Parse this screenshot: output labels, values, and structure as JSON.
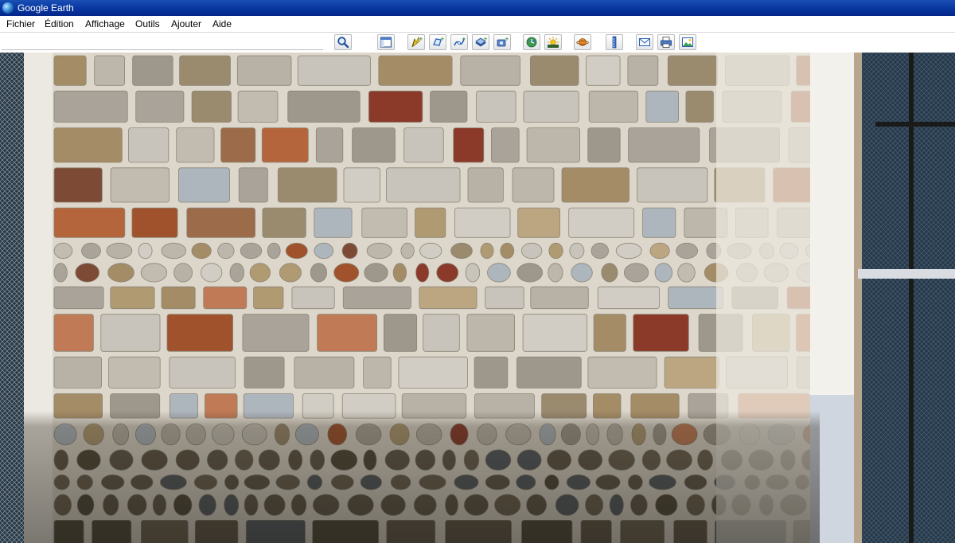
{
  "window": {
    "title": "Google Earth"
  },
  "menu": {
    "items": [
      {
        "id": "fichier",
        "label": "Fichier"
      },
      {
        "id": "edition",
        "label": "Édition"
      },
      {
        "id": "affichage",
        "label": "Affichage"
      },
      {
        "id": "outils",
        "label": "Outils"
      },
      {
        "id": "ajouter",
        "label": "Ajouter"
      },
      {
        "id": "aide",
        "label": "Aide"
      }
    ]
  },
  "toolbar": {
    "search_value": "",
    "buttons": [
      {
        "icon": "search-icon"
      },
      {
        "icon": "sidebar-toggle-icon"
      },
      {
        "icon": "placemark-icon"
      },
      {
        "icon": "polygon-icon"
      },
      {
        "icon": "path-icon"
      },
      {
        "icon": "image-overlay-icon"
      },
      {
        "icon": "record-tour-icon"
      },
      {
        "icon": "historical-imagery-icon"
      },
      {
        "icon": "sunlight-icon"
      },
      {
        "icon": "planets-icon"
      },
      {
        "icon": "ruler-icon"
      },
      {
        "icon": "email-icon"
      },
      {
        "icon": "print-icon"
      },
      {
        "icon": "save-image-icon"
      }
    ]
  },
  "viewport": {
    "content": "street-view-stone-wall"
  },
  "colors": {
    "titlebar": "#0a3aa3",
    "mortar": "#d9d4c8",
    "toolbar_bg": "#ffffff"
  }
}
